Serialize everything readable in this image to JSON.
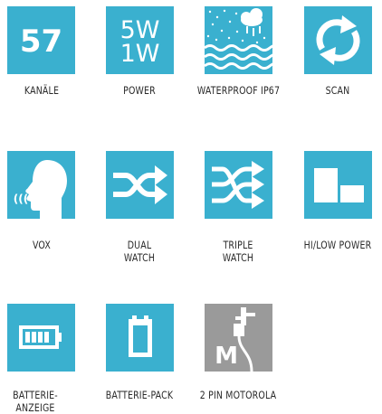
{
  "colors": {
    "tile_accent": "#3ab0cf",
    "tile_gray": "#9a9a9a",
    "label_text": "#2a2a2a"
  },
  "features": [
    {
      "id": "kanaele",
      "icon": "channels-number-icon",
      "icon_text": "57",
      "label": [
        "KANÄLE"
      ]
    },
    {
      "id": "power",
      "icon": "power-watt-icon",
      "icon_text": [
        "5W",
        "1W"
      ],
      "label": [
        "POWER"
      ]
    },
    {
      "id": "waterproof",
      "icon": "waterproof-rain-waves-icon",
      "label": [
        "WATERPROOF IP67"
      ]
    },
    {
      "id": "scan",
      "icon": "scan-refresh-arrows-icon",
      "label": [
        "SCAN"
      ]
    },
    {
      "id": "vox",
      "icon": "vox-speaking-head-icon",
      "icon_text": "(((",
      "label": [
        "VOX"
      ]
    },
    {
      "id": "dual-watch",
      "icon": "dual-watch-crossing-arrows-icon",
      "label": [
        "DUAL",
        "WATCH"
      ]
    },
    {
      "id": "triple-watch",
      "icon": "triple-watch-crossing-arrows-icon",
      "label": [
        "TRIPLE",
        "WATCH"
      ]
    },
    {
      "id": "hi-low-power",
      "icon": "hi-low-power-blocks-icon",
      "label": [
        "HI/LOW POWER"
      ]
    },
    {
      "id": "batterieanzeige",
      "icon": "battery-indicator-icon",
      "label": [
        "BATTERIE-",
        "ANZEIGE"
      ]
    },
    {
      "id": "batterie-pack",
      "icon": "battery-pack-icon",
      "label": [
        "BATTERIE-PACK"
      ]
    },
    {
      "id": "2pin-motorola",
      "icon": "motorola-2pin-connector-icon",
      "icon_text": "M",
      "label": [
        "2 PIN MOTOROLA"
      ]
    }
  ]
}
